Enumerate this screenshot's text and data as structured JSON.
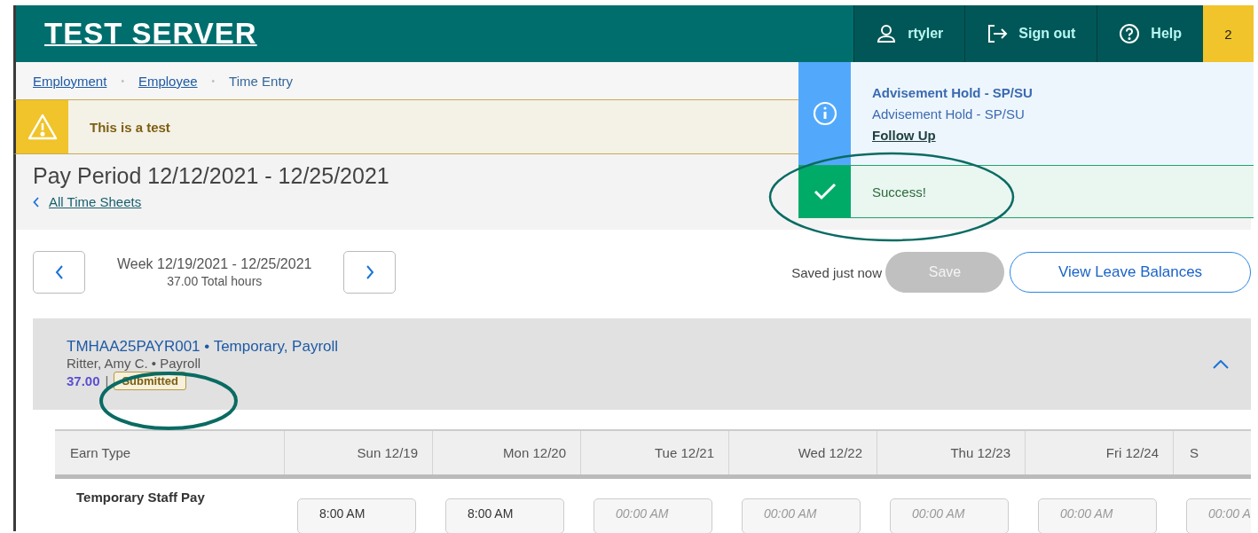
{
  "header": {
    "logo": "TEST SERVER",
    "menu": [
      {
        "kind": "user",
        "label": "rtyler"
      },
      {
        "kind": "signout",
        "label": "Sign out"
      },
      {
        "kind": "help",
        "label": "Help"
      }
    ],
    "notification_count": "2"
  },
  "breadcrumbs": [
    {
      "label": "Employment",
      "link": true
    },
    {
      "label": "Employee",
      "link": true
    },
    {
      "label": "Time Entry",
      "link": false
    }
  ],
  "breadcrumb_separator": "•",
  "alert": {
    "text": "This is a test"
  },
  "notifications": [
    {
      "kind": "info",
      "title": "Advisement Hold - SP/SU",
      "message": "Advisement Hold - SP/SU",
      "link": "Follow Up"
    },
    {
      "kind": "success",
      "title": "Success!"
    }
  ],
  "pay_period": {
    "title": "Pay Period 12/12/2021 - 12/25/2021",
    "back_link": "All Time Sheets"
  },
  "week": {
    "label": "Week 12/19/2021 - 12/25/2021",
    "total": "37.00 Total hours"
  },
  "save_status": "Saved just now",
  "save_button": {
    "label": "Save",
    "disabled": true
  },
  "leave_button": {
    "label": "View Leave Balances"
  },
  "job": {
    "title": "TMHAA25PAYR001 • Temporary, Payroll",
    "subtitle": "Ritter, Amy C. • Payroll",
    "hours": "37.00",
    "separator": "|",
    "status": "Submitted",
    "expanded": true
  },
  "table": {
    "columns": [
      "Earn Type",
      "Sun 12/19",
      "Mon 12/20",
      "Tue 12/21",
      "Wed 12/22",
      "Thu 12/23",
      "Fri 12/24",
      "S"
    ],
    "rows": [
      {
        "earn_type": "Temporary Staff Pay",
        "cells": [
          {
            "value": "8:00 AM"
          },
          {
            "value": "8:00 AM"
          },
          {
            "placeholder": "00:00 AM"
          },
          {
            "placeholder": "00:00 AM"
          },
          {
            "placeholder": "00:00 AM"
          },
          {
            "placeholder": "00:00 AM"
          },
          {
            "placeholder": "00:00 A"
          }
        ]
      }
    ]
  }
}
